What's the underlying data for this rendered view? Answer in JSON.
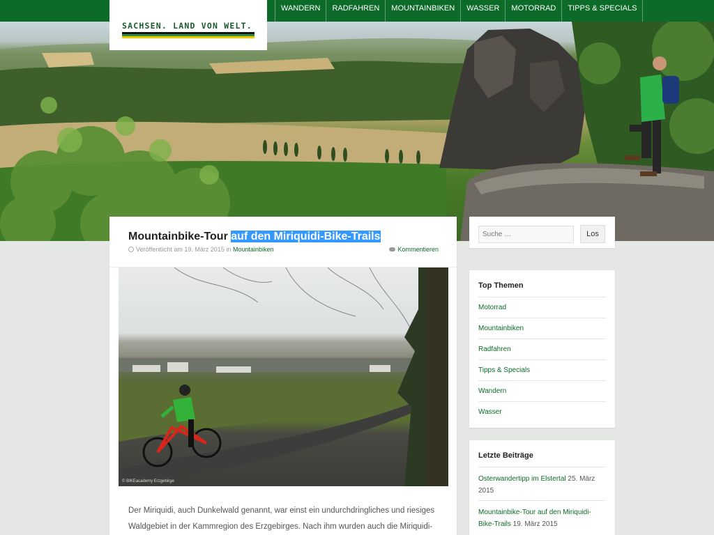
{
  "logo": {
    "text": "SACHSEN. LAND VON WELT."
  },
  "nav": {
    "items": [
      {
        "label": "WANDERN"
      },
      {
        "label": "RADFAHREN"
      },
      {
        "label": "MOUNTAINBIKEN"
      },
      {
        "label": "WASSER"
      },
      {
        "label": "MOTORRAD"
      },
      {
        "label": "TIPPS & SPECIALS"
      }
    ]
  },
  "post": {
    "title_plain": "Mountainbike-Tour ",
    "title_highlighted": "auf den Miriquidi-Bike-Trails",
    "meta_published": "Veröffentlicht am 19. März 2015",
    "meta_in": "in",
    "meta_category": "Mountainbiken",
    "comments_label": "Kommentieren",
    "image_caption": "© BIKEacademy Erzgebirge",
    "text": "Der Miriquidi, auch Dunkelwald genannt, war einst ein undurchdringliches und riesiges Waldgebiet in der Kammregion des Erzgebirges. Nach ihm wurden auch die Miriquidi-"
  },
  "search": {
    "placeholder": "Suche …",
    "button_label": "Los"
  },
  "top_topics": {
    "title": "Top Themen",
    "items": [
      {
        "label": "Motorrad"
      },
      {
        "label": "Mountainbiken"
      },
      {
        "label": "Radfahren"
      },
      {
        "label": "Tipps & Specials"
      },
      {
        "label": "Wandern"
      },
      {
        "label": "Wasser"
      }
    ]
  },
  "recent_posts": {
    "title": "Letzte Beiträge",
    "items": [
      {
        "label": "Osterwandertipp im Elstertal",
        "date": " 25. März 2015"
      },
      {
        "label": "Mountainbike-Tour auf den Miriquidi-Bike-Trails",
        "date": " 19. März 2015"
      }
    ]
  },
  "colors": {
    "brand_green": "#0d6b2a",
    "selection_blue": "#3399ff",
    "logo_stripe_black": "#111111",
    "logo_stripe_green": "#2e8b3a",
    "logo_stripe_yellow": "#f2c500"
  }
}
